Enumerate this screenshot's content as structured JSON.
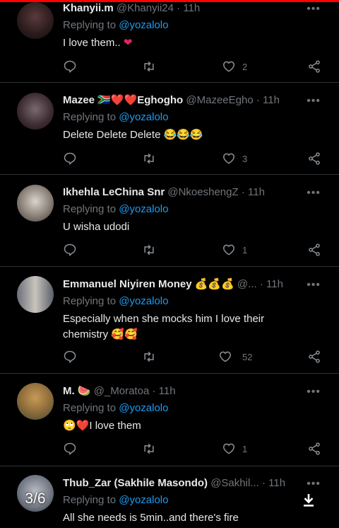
{
  "tweets": [
    {
      "name": "Khanyii.m",
      "handle": "@Khanyii24",
      "time": "11h",
      "reply_prefix": "Replying to",
      "reply_to": "@yozalolo",
      "text": "I love them..",
      "likes": "2"
    },
    {
      "name": "Mazee 🇿🇦❤️❤️Eghogho",
      "handle": "@MazeeEgho",
      "time": "11h",
      "reply_prefix": "Replying to",
      "reply_to": "@yozalolo",
      "text": "Delete Delete Delete 😂😂😂",
      "likes": "3"
    },
    {
      "name": "Ikhehla LeChina Snr",
      "handle": "@NkoeshengZ",
      "time": "11h",
      "reply_prefix": "Replying to",
      "reply_to": "@yozalolo",
      "text": "U wisha udodi",
      "likes": "1"
    },
    {
      "name": "Emmanuel Niyiren Money 💰💰💰",
      "handle": "@...",
      "time": "11h",
      "reply_prefix": "Replying to",
      "reply_to": "@yozalolo",
      "text": "Especially when she mocks him I love their chemistry 🥰🥰",
      "likes": "52"
    },
    {
      "name": "M. 🍉",
      "handle": "@_Moratoa",
      "time": "11h",
      "reply_prefix": "Replying to",
      "reply_to": "@yozalolo",
      "text": "🙄❤️I love them",
      "likes": "1"
    },
    {
      "name": "Thub_Zar (Sakhile Masondo)",
      "handle": "@Sakhil...",
      "time": "11h",
      "reply_prefix": "Replying to",
      "reply_to": "@yozalolo",
      "text": "All she needs is 5min..and there's fire",
      "likes": ""
    }
  ],
  "separator": "·",
  "more_glyph": "•••",
  "page_indicator": "3/6",
  "icons": {
    "reply": "reply-icon",
    "retweet": "retweet-icon",
    "like": "heart-icon",
    "share": "share-icon",
    "download": "download-icon"
  }
}
